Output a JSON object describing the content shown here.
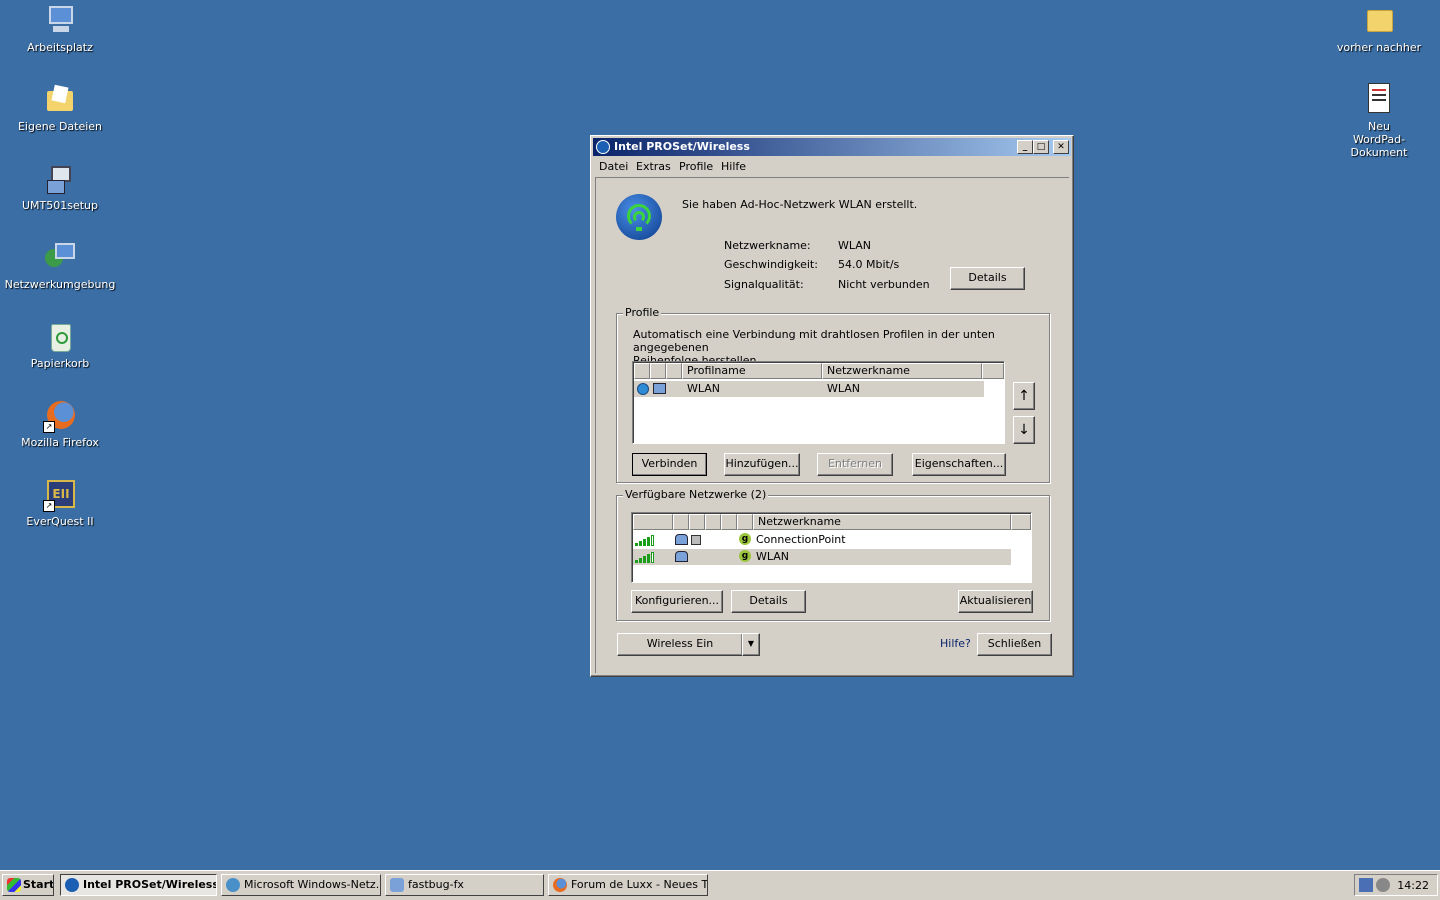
{
  "desktop": {
    "icons_left": [
      {
        "label": "Arbeitsplatz",
        "icon": "my-computer-icon"
      },
      {
        "label": "Eigene Dateien",
        "icon": "my-documents-icon"
      },
      {
        "label": "UMT501setup",
        "icon": "setup-icon"
      },
      {
        "label": "Netzwerkumgebung",
        "icon": "network-icon"
      },
      {
        "label": "Papierkorb",
        "icon": "recycle-bin-icon"
      },
      {
        "label": "Mozilla Firefox",
        "icon": "firefox-icon"
      },
      {
        "label": "EverQuest II",
        "icon": "everquest-icon"
      }
    ],
    "icons_right": [
      {
        "label": "vorher nachher",
        "icon": "folder-icon"
      },
      {
        "label": "Neu WordPad-Dokument",
        "icon": "wordpad-doc-icon"
      }
    ]
  },
  "window": {
    "title": "Intel PROSet/Wireless",
    "controls": {
      "minimize": "_",
      "maximize": "□",
      "close": "✕"
    },
    "menu": [
      "Datei",
      "Extras",
      "Profile",
      "Hilfe"
    ],
    "status_message": "Sie haben Ad-Hoc-Netzwerk WLAN erstellt.",
    "info": [
      {
        "label": "Netzwerkname:",
        "value": "WLAN"
      },
      {
        "label": "Geschwindigkeit:",
        "value": "54.0 Mbit/s"
      },
      {
        "label": "Signalqualität:",
        "value": "Nicht verbunden"
      }
    ],
    "details_button": "Details",
    "profiles": {
      "legend": "Profile",
      "description_line1": "Automatisch eine Verbindung mit drahtlosen Profilen in der unten angegebenen",
      "description_line2": "Reihenfolge herstellen.",
      "columns": [
        "Profilname",
        "Netzwerkname"
      ],
      "rows": [
        {
          "profile": "WLAN",
          "network": "WLAN"
        }
      ],
      "move_up": "↑",
      "move_down": "↓",
      "buttons": {
        "connect": "Verbinden",
        "add": "Hinzufügen...",
        "remove": "Entfernen",
        "properties": "Eigenschaften..."
      }
    },
    "available": {
      "legend": "Verfügbare Netzwerke (2)",
      "column": "Netzwerkname",
      "band_label": "g",
      "rows": [
        {
          "name": "ConnectionPoint",
          "signal_bars": 4,
          "adhoc": true,
          "secured": true
        },
        {
          "name": "WLAN",
          "signal_bars": 4,
          "adhoc": true,
          "secured": false
        }
      ],
      "buttons": {
        "configure": "Konfigurieren...",
        "details": "Details",
        "refresh": "Aktualisieren"
      }
    },
    "wireless_button": "Wireless Ein",
    "wireless_dropdown": "▼",
    "help_link": "Hilfe?",
    "close_button": "Schließen"
  },
  "taskbar": {
    "start": "Start",
    "items": [
      {
        "label": "Intel PROSet/Wireless",
        "active": true
      },
      {
        "label": "Microsoft Windows-Netz...",
        "active": false
      },
      {
        "label": "fastbug-fx",
        "active": false
      },
      {
        "label": "Forum de Luxx - Neues T...",
        "active": false
      }
    ],
    "clock": "14:22"
  },
  "colors": {
    "desktop": "#3a6ea5",
    "titlebar_start": "#0a246a",
    "titlebar_end": "#a6caf0",
    "signal": "#1a9e1a"
  }
}
